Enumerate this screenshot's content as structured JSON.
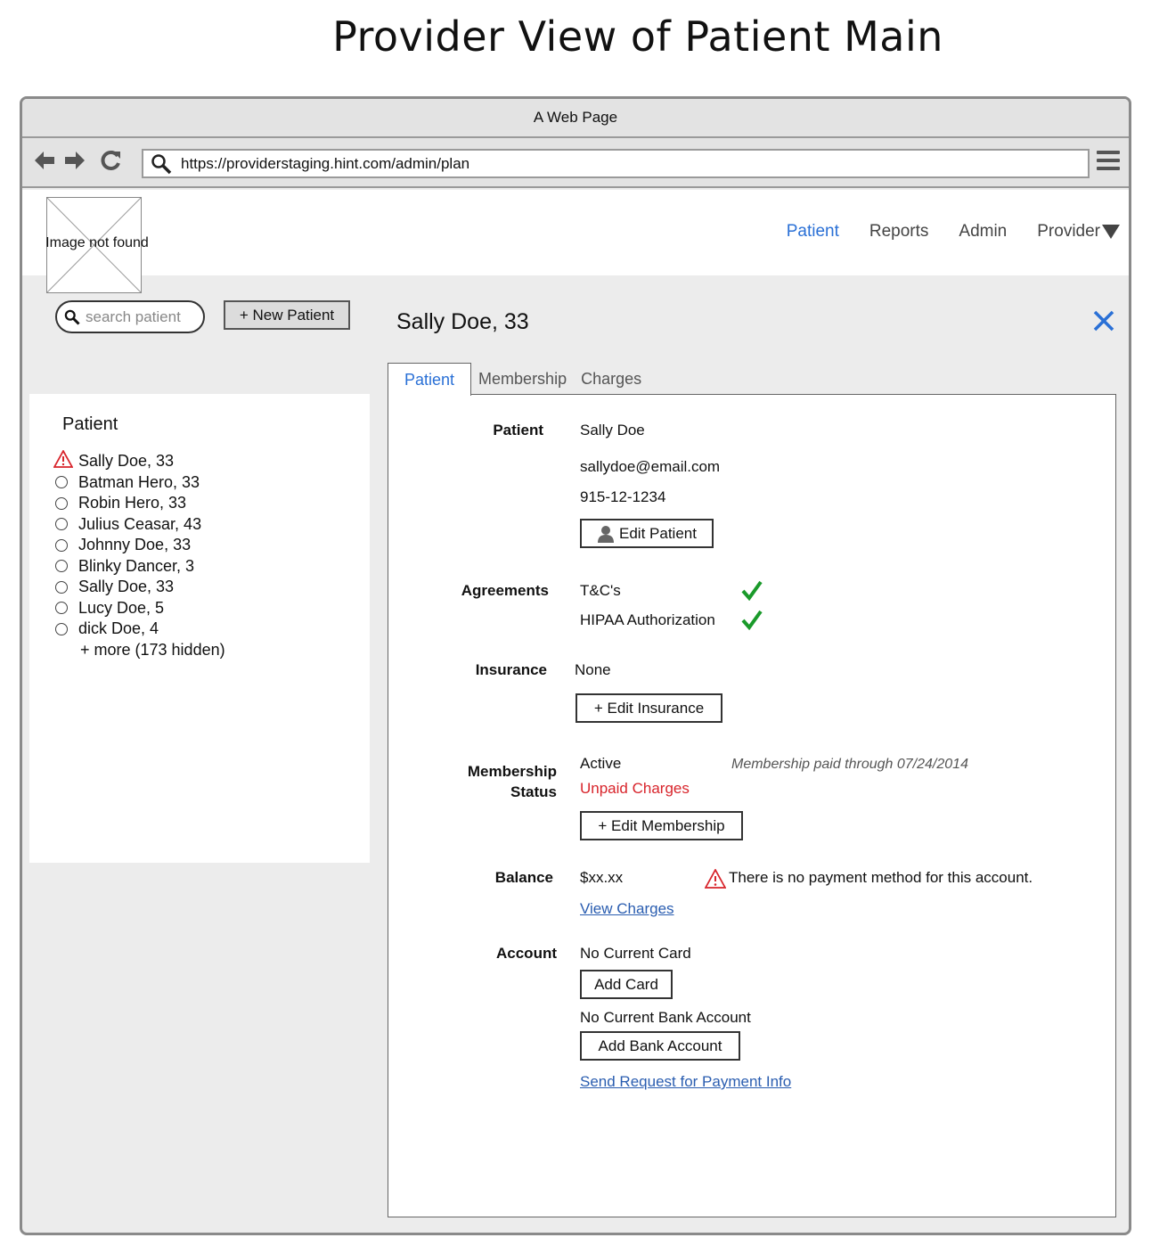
{
  "heading": "Provider View of Patient Main",
  "window": {
    "title": "A Web Page",
    "url": "https://providerstaging.hint.com/admin/plan"
  },
  "logo": {
    "alt_text": "Image not found"
  },
  "topnav": {
    "patient": "Patient",
    "reports": "Reports",
    "admin": "Admin",
    "provider": "Provider"
  },
  "search": {
    "placeholder": "search patient"
  },
  "new_patient_button": "+ New Patient",
  "sidebar": {
    "title": "Patient",
    "patients": [
      {
        "name": "Sally Doe, 33",
        "status": "warning"
      },
      {
        "name": "Batman Hero, 33",
        "status": "normal"
      },
      {
        "name": "Robin Hero, 33",
        "status": "normal"
      },
      {
        "name": "Julius Ceasar, 43",
        "status": "normal"
      },
      {
        "name": "Johnny Doe, 33",
        "status": "normal"
      },
      {
        "name": "Blinky Dancer, 3",
        "status": "normal"
      },
      {
        "name": "Sally Doe, 33",
        "status": "normal"
      },
      {
        "name": "Lucy Doe, 5",
        "status": "normal"
      },
      {
        "name": "dick Doe, 4",
        "status": "normal"
      }
    ],
    "more": "+ more (173 hidden)"
  },
  "detail": {
    "title": "Sally Doe, 33",
    "tabs": [
      "Patient",
      "Membership",
      "Charges"
    ],
    "patient": {
      "label": "Patient",
      "name": "Sally Doe",
      "email": "sallydoe@email.com",
      "phone": "915-12-1234",
      "edit_button": "Edit Patient"
    },
    "agreements": {
      "label": "Agreements",
      "items": [
        "T&C's",
        "HIPAA Authorization"
      ]
    },
    "insurance": {
      "label": "Insurance",
      "value": "None",
      "edit_button": "+ Edit Insurance"
    },
    "membership": {
      "label_line1": "Membership",
      "label_line2": "Status",
      "status": "Active",
      "alert": "Unpaid Charges",
      "note": "Membership paid through 07/24/2014",
      "edit_button": "+ Edit Membership"
    },
    "balance": {
      "label": "Balance",
      "value": "$xx.xx",
      "warning": "There is no payment method for this account.",
      "view_link": "View Charges"
    },
    "account": {
      "label": "Account",
      "card_status": "No Current Card",
      "add_card_button": "Add Card",
      "bank_status": "No Current Bank Account",
      "add_bank_button": "Add Bank Account",
      "request_link": "Send Request for Payment Info"
    }
  },
  "colors": {
    "link_blue": "#2a70d6",
    "alert_red": "#d8242b",
    "check_green": "#1a9a2a",
    "panel_gray": "#ececec"
  }
}
